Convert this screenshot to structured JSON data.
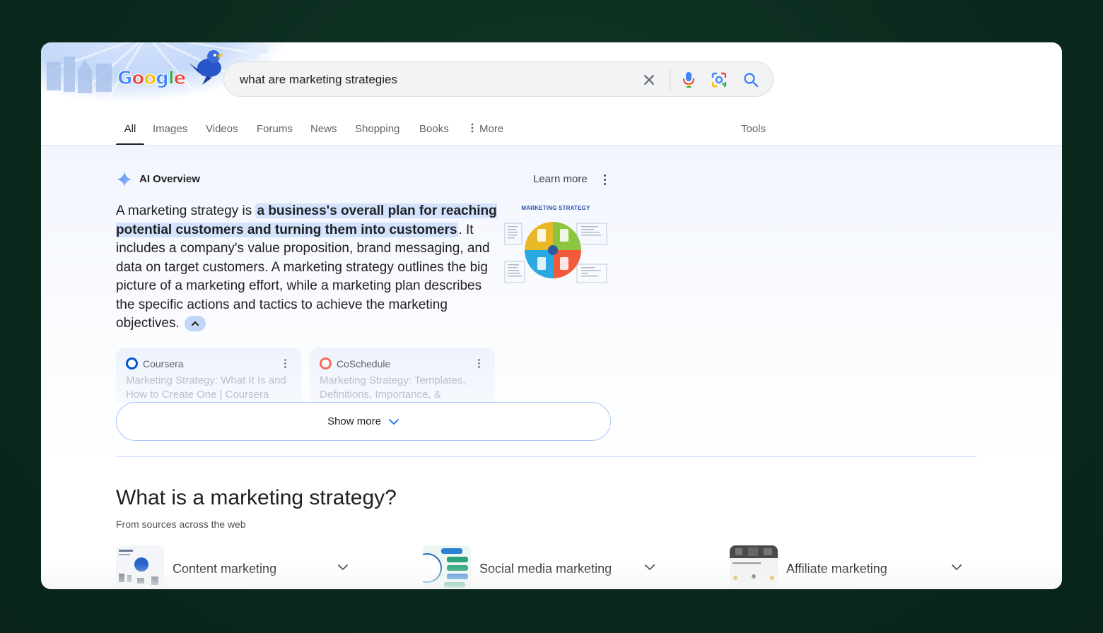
{
  "doodle": {
    "logo_letters": [
      "G",
      "o",
      "o",
      "g",
      "l",
      "e"
    ]
  },
  "search": {
    "query": "what are marketing strategies"
  },
  "tabs": [
    {
      "label": "All"
    },
    {
      "label": "Images"
    },
    {
      "label": "Videos"
    },
    {
      "label": "Forums"
    },
    {
      "label": "News"
    },
    {
      "label": "Shopping"
    },
    {
      "label": "Books"
    },
    {
      "label": "More"
    }
  ],
  "tools_label": "Tools",
  "ai_overview": {
    "title": "AI Overview",
    "learn_more": "Learn more",
    "text_before": "A marketing strategy is ",
    "text_highlight": "a business's overall plan for reaching potential customers and turning them into customers",
    "text_after": ". It includes a company's value proposition, brand messaging, and data on target customers. A marketing strategy outlines the big picture of a marketing effort, while a marketing plan describes the specific actions and tactics to achieve the marketing objectives.",
    "image_caption": "MARKETING STRATEGY",
    "sources": [
      {
        "name": "Coursera",
        "title": "Marketing Strategy: What It Is and How to Create One | Coursera",
        "color": "#0056d2"
      },
      {
        "name": "CoSchedule",
        "title": "Marketing Strategy: Templates, Definitions, Importance, &",
        "color": "#f26d5b"
      }
    ],
    "show_more": "Show more"
  },
  "what_is": {
    "title": "What is a marketing strategy?",
    "subtitle": "From sources across the web",
    "topics": [
      {
        "label": "Content marketing"
      },
      {
        "label": "Social media marketing"
      },
      {
        "label": "Affiliate marketing"
      }
    ]
  },
  "colors": {
    "google_blue": "#4285f4",
    "google_red": "#ea4335",
    "google_yellow": "#fbbc05",
    "google_green": "#34a853",
    "highlight": "#d3e3fd"
  }
}
